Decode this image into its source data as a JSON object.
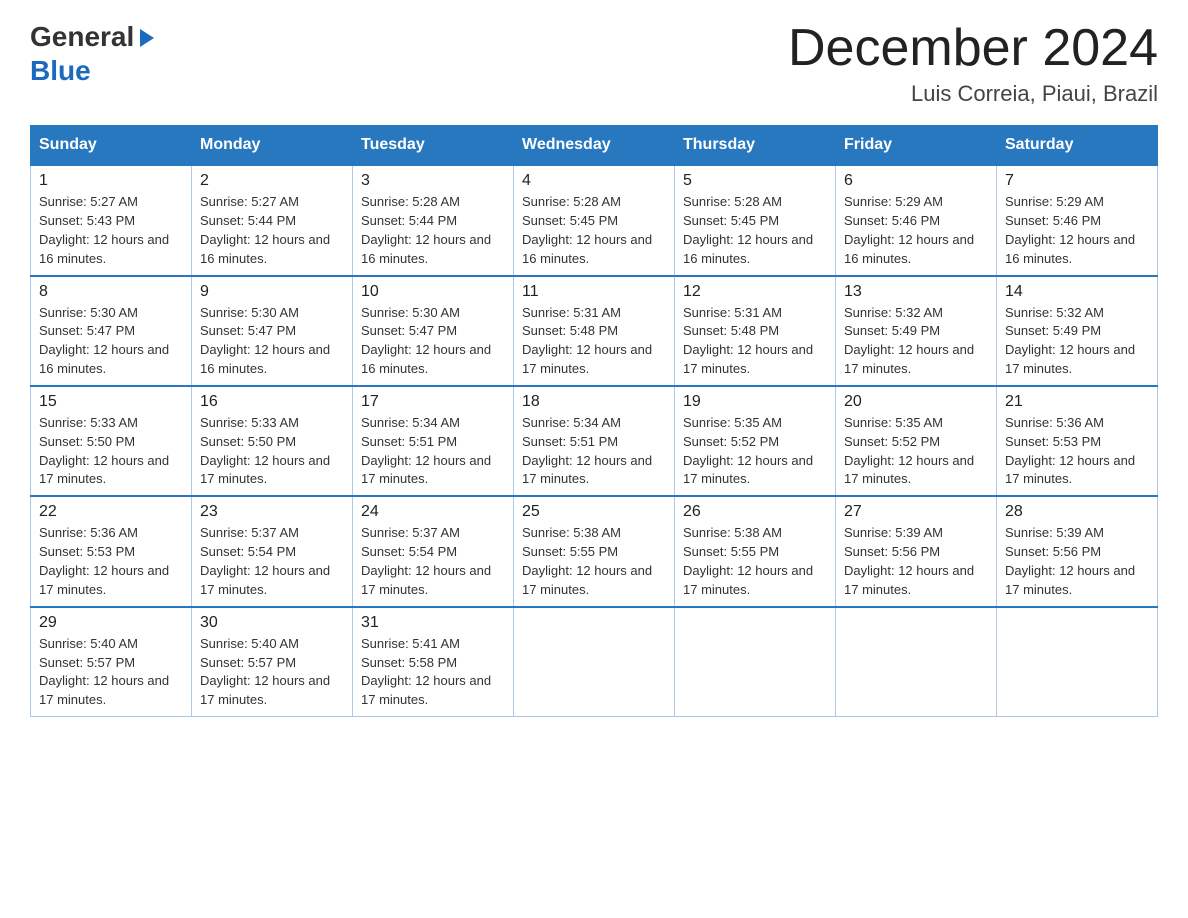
{
  "logo": {
    "text_general": "General",
    "text_blue": "Blue",
    "arrow": "▶"
  },
  "title": "December 2024",
  "location": "Luis Correia, Piaui, Brazil",
  "days_of_week": [
    "Sunday",
    "Monday",
    "Tuesday",
    "Wednesday",
    "Thursday",
    "Friday",
    "Saturday"
  ],
  "weeks": [
    [
      {
        "day": "1",
        "sunrise": "Sunrise: 5:27 AM",
        "sunset": "Sunset: 5:43 PM",
        "daylight": "Daylight: 12 hours and 16 minutes."
      },
      {
        "day": "2",
        "sunrise": "Sunrise: 5:27 AM",
        "sunset": "Sunset: 5:44 PM",
        "daylight": "Daylight: 12 hours and 16 minutes."
      },
      {
        "day": "3",
        "sunrise": "Sunrise: 5:28 AM",
        "sunset": "Sunset: 5:44 PM",
        "daylight": "Daylight: 12 hours and 16 minutes."
      },
      {
        "day": "4",
        "sunrise": "Sunrise: 5:28 AM",
        "sunset": "Sunset: 5:45 PM",
        "daylight": "Daylight: 12 hours and 16 minutes."
      },
      {
        "day": "5",
        "sunrise": "Sunrise: 5:28 AM",
        "sunset": "Sunset: 5:45 PM",
        "daylight": "Daylight: 12 hours and 16 minutes."
      },
      {
        "day": "6",
        "sunrise": "Sunrise: 5:29 AM",
        "sunset": "Sunset: 5:46 PM",
        "daylight": "Daylight: 12 hours and 16 minutes."
      },
      {
        "day": "7",
        "sunrise": "Sunrise: 5:29 AM",
        "sunset": "Sunset: 5:46 PM",
        "daylight": "Daylight: 12 hours and 16 minutes."
      }
    ],
    [
      {
        "day": "8",
        "sunrise": "Sunrise: 5:30 AM",
        "sunset": "Sunset: 5:47 PM",
        "daylight": "Daylight: 12 hours and 16 minutes."
      },
      {
        "day": "9",
        "sunrise": "Sunrise: 5:30 AM",
        "sunset": "Sunset: 5:47 PM",
        "daylight": "Daylight: 12 hours and 16 minutes."
      },
      {
        "day": "10",
        "sunrise": "Sunrise: 5:30 AM",
        "sunset": "Sunset: 5:47 PM",
        "daylight": "Daylight: 12 hours and 16 minutes."
      },
      {
        "day": "11",
        "sunrise": "Sunrise: 5:31 AM",
        "sunset": "Sunset: 5:48 PM",
        "daylight": "Daylight: 12 hours and 17 minutes."
      },
      {
        "day": "12",
        "sunrise": "Sunrise: 5:31 AM",
        "sunset": "Sunset: 5:48 PM",
        "daylight": "Daylight: 12 hours and 17 minutes."
      },
      {
        "day": "13",
        "sunrise": "Sunrise: 5:32 AM",
        "sunset": "Sunset: 5:49 PM",
        "daylight": "Daylight: 12 hours and 17 minutes."
      },
      {
        "day": "14",
        "sunrise": "Sunrise: 5:32 AM",
        "sunset": "Sunset: 5:49 PM",
        "daylight": "Daylight: 12 hours and 17 minutes."
      }
    ],
    [
      {
        "day": "15",
        "sunrise": "Sunrise: 5:33 AM",
        "sunset": "Sunset: 5:50 PM",
        "daylight": "Daylight: 12 hours and 17 minutes."
      },
      {
        "day": "16",
        "sunrise": "Sunrise: 5:33 AM",
        "sunset": "Sunset: 5:50 PM",
        "daylight": "Daylight: 12 hours and 17 minutes."
      },
      {
        "day": "17",
        "sunrise": "Sunrise: 5:34 AM",
        "sunset": "Sunset: 5:51 PM",
        "daylight": "Daylight: 12 hours and 17 minutes."
      },
      {
        "day": "18",
        "sunrise": "Sunrise: 5:34 AM",
        "sunset": "Sunset: 5:51 PM",
        "daylight": "Daylight: 12 hours and 17 minutes."
      },
      {
        "day": "19",
        "sunrise": "Sunrise: 5:35 AM",
        "sunset": "Sunset: 5:52 PM",
        "daylight": "Daylight: 12 hours and 17 minutes."
      },
      {
        "day": "20",
        "sunrise": "Sunrise: 5:35 AM",
        "sunset": "Sunset: 5:52 PM",
        "daylight": "Daylight: 12 hours and 17 minutes."
      },
      {
        "day": "21",
        "sunrise": "Sunrise: 5:36 AM",
        "sunset": "Sunset: 5:53 PM",
        "daylight": "Daylight: 12 hours and 17 minutes."
      }
    ],
    [
      {
        "day": "22",
        "sunrise": "Sunrise: 5:36 AM",
        "sunset": "Sunset: 5:53 PM",
        "daylight": "Daylight: 12 hours and 17 minutes."
      },
      {
        "day": "23",
        "sunrise": "Sunrise: 5:37 AM",
        "sunset": "Sunset: 5:54 PM",
        "daylight": "Daylight: 12 hours and 17 minutes."
      },
      {
        "day": "24",
        "sunrise": "Sunrise: 5:37 AM",
        "sunset": "Sunset: 5:54 PM",
        "daylight": "Daylight: 12 hours and 17 minutes."
      },
      {
        "day": "25",
        "sunrise": "Sunrise: 5:38 AM",
        "sunset": "Sunset: 5:55 PM",
        "daylight": "Daylight: 12 hours and 17 minutes."
      },
      {
        "day": "26",
        "sunrise": "Sunrise: 5:38 AM",
        "sunset": "Sunset: 5:55 PM",
        "daylight": "Daylight: 12 hours and 17 minutes."
      },
      {
        "day": "27",
        "sunrise": "Sunrise: 5:39 AM",
        "sunset": "Sunset: 5:56 PM",
        "daylight": "Daylight: 12 hours and 17 minutes."
      },
      {
        "day": "28",
        "sunrise": "Sunrise: 5:39 AM",
        "sunset": "Sunset: 5:56 PM",
        "daylight": "Daylight: 12 hours and 17 minutes."
      }
    ],
    [
      {
        "day": "29",
        "sunrise": "Sunrise: 5:40 AM",
        "sunset": "Sunset: 5:57 PM",
        "daylight": "Daylight: 12 hours and 17 minutes."
      },
      {
        "day": "30",
        "sunrise": "Sunrise: 5:40 AM",
        "sunset": "Sunset: 5:57 PM",
        "daylight": "Daylight: 12 hours and 17 minutes."
      },
      {
        "day": "31",
        "sunrise": "Sunrise: 5:41 AM",
        "sunset": "Sunset: 5:58 PM",
        "daylight": "Daylight: 12 hours and 17 minutes."
      },
      {
        "day": "",
        "sunrise": "",
        "sunset": "",
        "daylight": ""
      },
      {
        "day": "",
        "sunrise": "",
        "sunset": "",
        "daylight": ""
      },
      {
        "day": "",
        "sunrise": "",
        "sunset": "",
        "daylight": ""
      },
      {
        "day": "",
        "sunrise": "",
        "sunset": "",
        "daylight": ""
      }
    ]
  ],
  "colors": {
    "header_bg": "#2878c0",
    "header_text": "#ffffff",
    "border": "#b0c8e8",
    "row_top_border": "#2878c0"
  }
}
